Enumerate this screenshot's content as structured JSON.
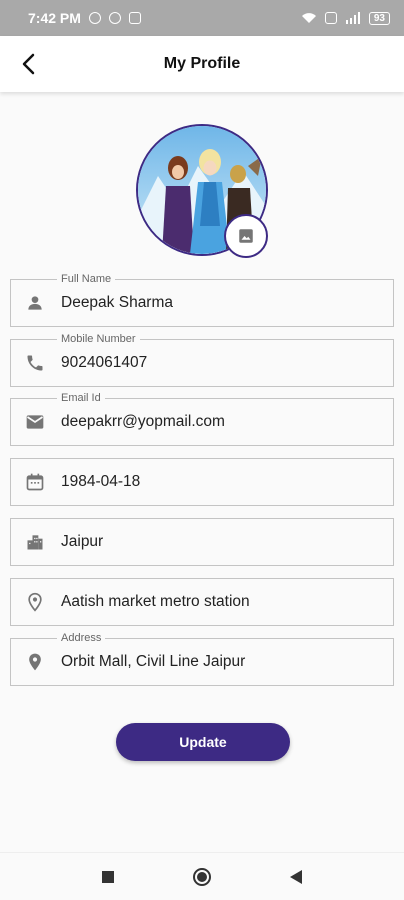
{
  "status_bar": {
    "time": "7:42 PM",
    "battery": "93"
  },
  "app_bar": {
    "title": "My Profile"
  },
  "fields": [
    {
      "label": "Full Name",
      "value": "Deepak Sharma",
      "icon": "person-icon"
    },
    {
      "label": "Mobile Number",
      "value": "9024061407",
      "icon": "phone-icon"
    },
    {
      "label": "Email Id",
      "value": "deepakrr@yopmail.com",
      "icon": "email-icon"
    },
    {
      "label": "",
      "value": "1984-04-18",
      "icon": "calendar-icon"
    },
    {
      "label": "",
      "value": "Jaipur",
      "icon": "city-icon"
    },
    {
      "label": "",
      "value": "Aatish market metro station",
      "icon": "location-outline-icon"
    },
    {
      "label": "Address",
      "value": "Orbit Mall, Civil Line Jaipur",
      "icon": "location-filled-icon"
    }
  ],
  "update_button": {
    "label": "Update"
  },
  "colors": {
    "primary": "#3d2a84",
    "icon": "#757575",
    "border": "#c4c4c4"
  }
}
